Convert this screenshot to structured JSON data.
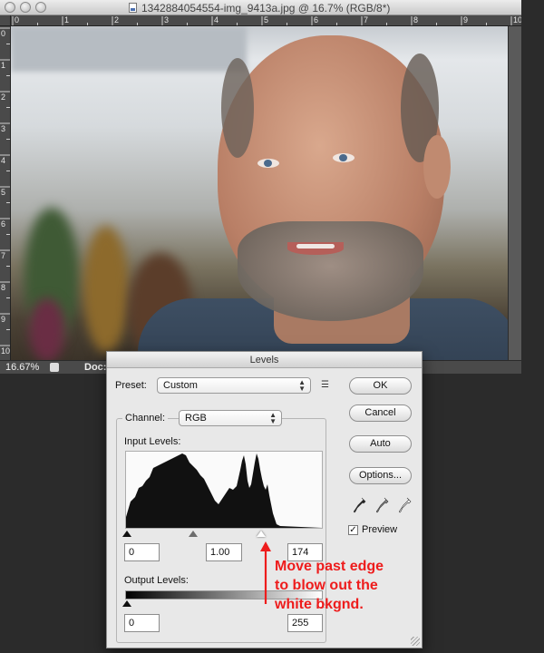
{
  "window": {
    "title": "1342884054554-img_9413a.jpg @ 16.7% (RGB/8*)",
    "zoom": "16.67%",
    "status_label": "Doc:"
  },
  "rulers": {
    "top": [
      "0",
      "1",
      "2",
      "3",
      "4",
      "5",
      "6",
      "7",
      "8",
      "9",
      "10"
    ],
    "left": [
      "0",
      "1",
      "2",
      "3",
      "4",
      "5",
      "6",
      "7",
      "8",
      "9",
      "10"
    ]
  },
  "levels": {
    "title": "Levels",
    "preset_label": "Preset:",
    "preset_value": "Custom",
    "channel_label": "Channel:",
    "channel_value": "RGB",
    "input_label": "Input Levels:",
    "input_black": "0",
    "input_gamma": "1.00",
    "input_white": "174",
    "output_label": "Output Levels:",
    "output_black": "0",
    "output_white": "255",
    "buttons": {
      "ok": "OK",
      "cancel": "Cancel",
      "auto": "Auto",
      "options": "Options..."
    },
    "preview_label": "Preview",
    "preview_checked": true
  },
  "annotation": {
    "lines": [
      "Move past edge",
      "to blow out the",
      "white bkgnd."
    ],
    "color": "#ee1c1c"
  },
  "icons": [
    "close-icon",
    "minimize-icon",
    "zoom-icon",
    "document-icon",
    "panel-menu-icon",
    "black-eyedropper-icon",
    "gray-eyedropper-icon",
    "white-eyedropper-icon",
    "checkmark-icon",
    "resize-grip-icon"
  ]
}
